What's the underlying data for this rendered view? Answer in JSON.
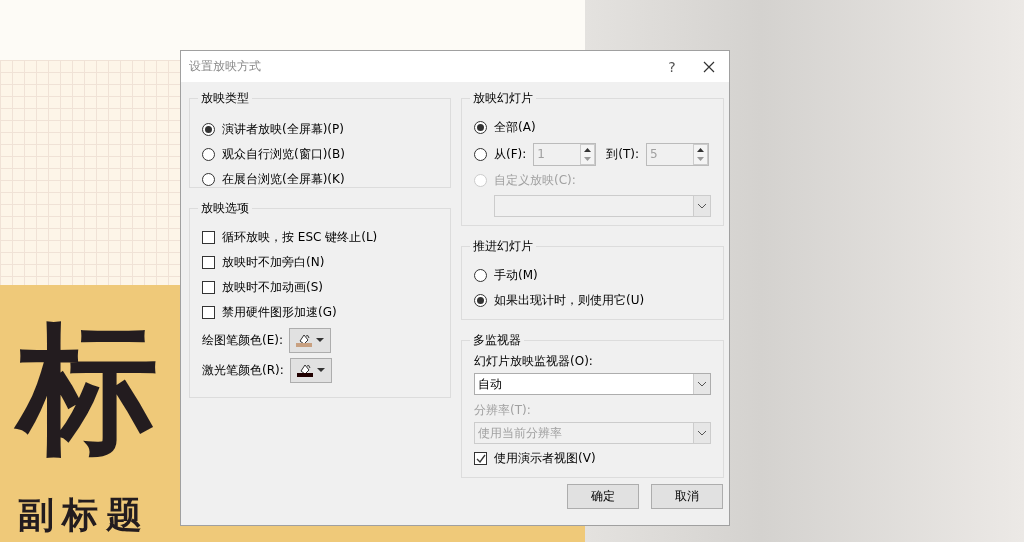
{
  "slide": {
    "title": "标",
    "subtitle": "副标题"
  },
  "dialog": {
    "title": "设置放映方式",
    "help": "?",
    "show_type": {
      "label": "放映类型",
      "options": [
        {
          "label": "演讲者放映(全屏幕)(P)",
          "selected": true
        },
        {
          "label": "观众自行浏览(窗口)(B)",
          "selected": false
        },
        {
          "label": "在展台浏览(全屏幕)(K)",
          "selected": false
        }
      ]
    },
    "show_options": {
      "label": "放映选项",
      "checkboxes": [
        {
          "label": "循环放映，按 ESC 键终止(L)",
          "checked": false
        },
        {
          "label": "放映时不加旁白(N)",
          "checked": false
        },
        {
          "label": "放映时不加动画(S)",
          "checked": false
        },
        {
          "label": "禁用硬件图形加速(G)",
          "checked": false
        }
      ],
      "pen_colors": [
        {
          "label": "绘图笔颜色(E):",
          "color": "#c8a080"
        },
        {
          "label": "激光笔颜色(R):",
          "color": "#200000"
        }
      ]
    },
    "show_slides": {
      "label": "放映幻灯片",
      "options": [
        {
          "label": "全部(A)",
          "selected": true,
          "disabled": false
        },
        {
          "label": "从(F):",
          "selected": false,
          "disabled": false
        },
        {
          "label": "自定义放映(C):",
          "selected": false,
          "disabled": true
        }
      ],
      "from": "1",
      "to_label": "到(T):",
      "to": "5"
    },
    "advance": {
      "label": "推进幻灯片",
      "options": [
        {
          "label": "手动(M)",
          "selected": false
        },
        {
          "label": "如果出现计时，则使用它(U)",
          "selected": true
        }
      ]
    },
    "monitors": {
      "label": "多监视器",
      "monitor_label": "幻灯片放映监视器(O):",
      "monitor_value": "自动",
      "resolution_label": "分辨率(T):",
      "resolution_value": "使用当前分辨率",
      "resolution_disabled": true,
      "presenter_view": {
        "label": "使用演示者视图(V)",
        "checked": true
      }
    },
    "buttons": [
      "确定",
      "取消"
    ]
  }
}
